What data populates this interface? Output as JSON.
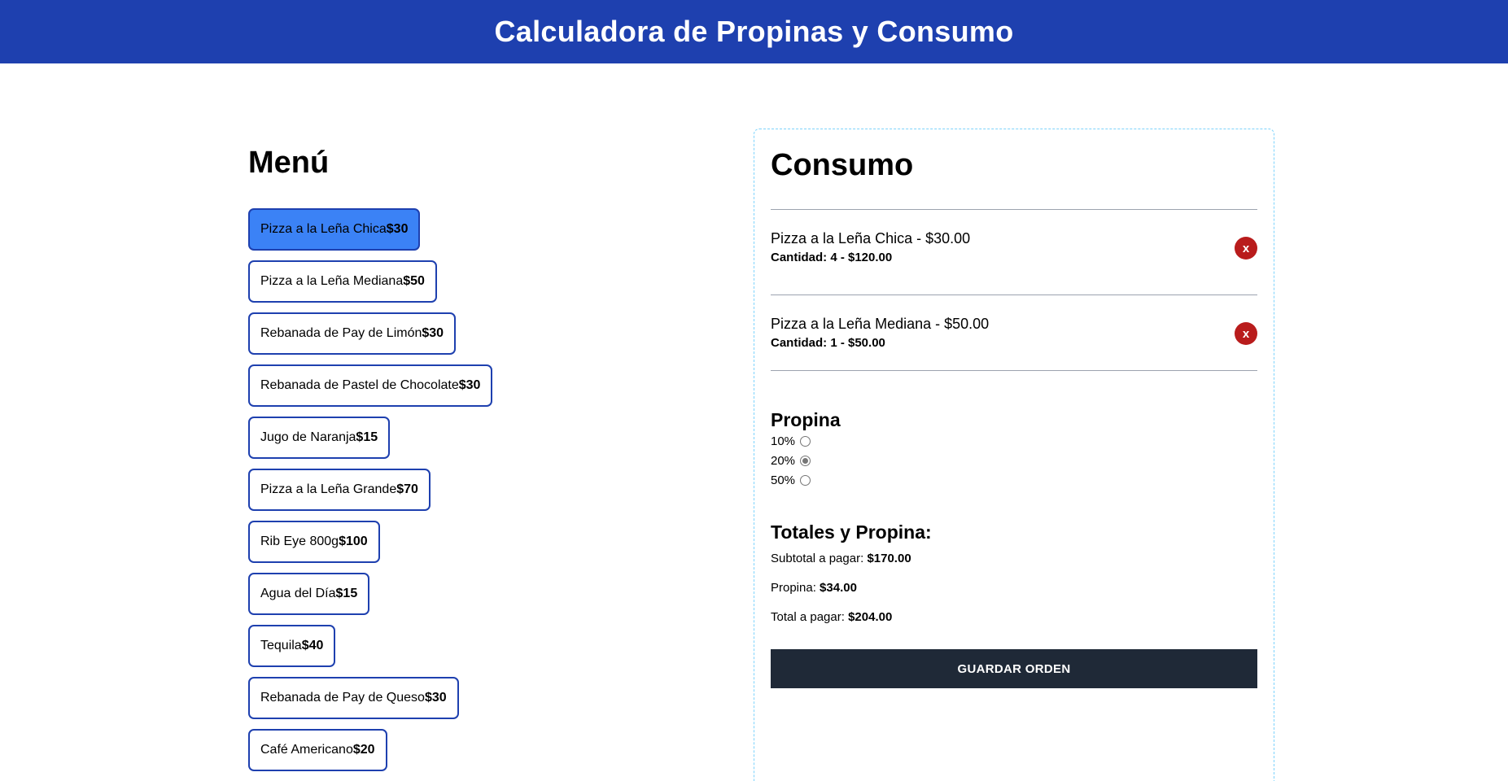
{
  "header": {
    "title": "Calculadora de Propinas y Consumo"
  },
  "menu": {
    "title": "Menú",
    "items": [
      {
        "name": "Pizza a la Leña Chica",
        "price": "$30"
      },
      {
        "name": "Pizza a la Leña Mediana",
        "price": "$50"
      },
      {
        "name": "Rebanada de Pay de Limón",
        "price": "$30"
      },
      {
        "name": "Rebanada de Pastel de Chocolate",
        "price": "$30"
      },
      {
        "name": "Jugo de Naranja",
        "price": "$15"
      },
      {
        "name": "Pizza a la Leña Grande",
        "price": "$70"
      },
      {
        "name": "Rib Eye 800g",
        "price": "$100"
      },
      {
        "name": "Agua del Día",
        "price": "$15"
      },
      {
        "name": "Tequila",
        "price": "$40"
      },
      {
        "name": "Rebanada de Pay de Queso",
        "price": "$30"
      },
      {
        "name": "Café Americano",
        "price": "$20"
      }
    ]
  },
  "consumo": {
    "title": "Consumo",
    "items": [
      {
        "name": "Pizza a la Leña Chica - $30.00",
        "qty": "Cantidad: 4 - $120.00",
        "remove": "x"
      },
      {
        "name": "Pizza a la Leña Mediana - $50.00",
        "qty": "Cantidad: 1 - $50.00",
        "remove": "x"
      }
    ],
    "propina": {
      "title": "Propina",
      "options": [
        "10%",
        "20%",
        "50%"
      ],
      "selected": "20%"
    },
    "totales": {
      "title": "Totales y Propina:",
      "subtotal_label": "Subtotal a pagar:",
      "subtotal_value": "$170.00",
      "propina_label": "Propina:",
      "propina_value": "$34.00",
      "total_label": "Total a pagar:",
      "total_value": "$204.00"
    },
    "save_label": "GUARDAR ORDEN"
  },
  "colors": {
    "header_bg": "#1e40af",
    "active_item": "#3b82f6",
    "remove_btn": "#b91c1c",
    "save_btn": "#1f2937"
  },
  "icons": {
    "remove": "close-icon"
  }
}
